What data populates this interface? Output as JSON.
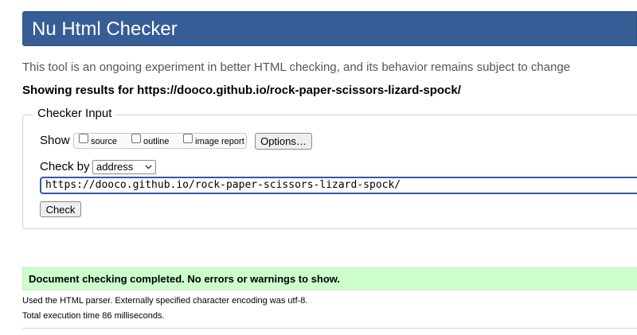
{
  "header": {
    "title": "Nu Html Checker"
  },
  "tagline": "This tool is an ongoing experiment in better HTML checking, and its behavior remains subject to change",
  "showing_results": "Showing results for https://dooco.github.io/rock-paper-scissors-lizard-spock/",
  "checker_input": {
    "legend": "Checker Input",
    "show_label": "Show",
    "options": [
      {
        "label": "source",
        "checked": false
      },
      {
        "label": "outline",
        "checked": false
      },
      {
        "label": "image report",
        "checked": false
      }
    ],
    "options_button": "Options…",
    "check_by_label": "Check by",
    "check_by_selected": "address",
    "url_value": "https://dooco.github.io/rock-paper-scissors-lizard-spock/",
    "check_button": "Check"
  },
  "result": {
    "message": "Document checking completed. No errors or warnings to show.",
    "background": "#ccffcc"
  },
  "info": {
    "parser": "Used the HTML parser. Externally specified character encoding was utf-8.",
    "time": "Total execution time 86 milliseconds."
  },
  "colors": {
    "header_bg": "#365d95",
    "input_focus": "#2f5aa7"
  }
}
